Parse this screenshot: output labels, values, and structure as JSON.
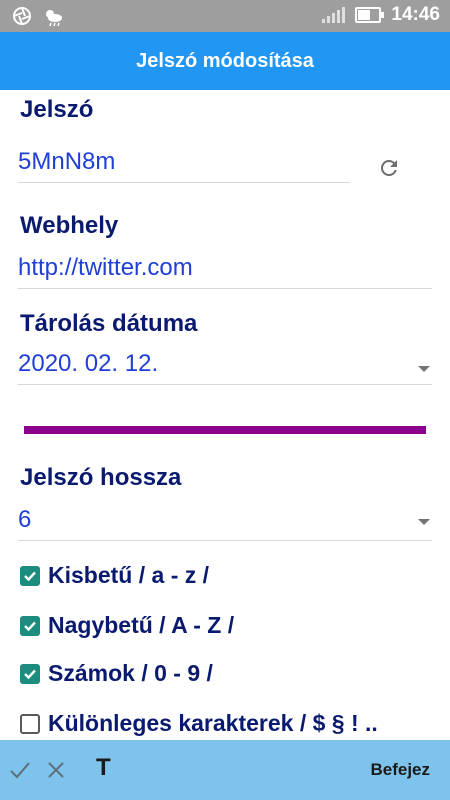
{
  "status_bar": {
    "time": "14:46"
  },
  "header": {
    "title": "Jelszó módosítása"
  },
  "password": {
    "label": "Jelszó",
    "value": "5MnN8m",
    "refresh_icon": "refresh-icon"
  },
  "website": {
    "label": "Webhely",
    "value": "http://twitter.com"
  },
  "storage_date": {
    "label": "Tárolás dátuma",
    "value": "2020. 02. 12."
  },
  "strength_bar": {
    "color": "#8b008b"
  },
  "password_length": {
    "label": "Jelszó hossza",
    "value": "6"
  },
  "options": [
    {
      "label": "Kisbetű / a - z /",
      "checked": true
    },
    {
      "label": "Nagybetű / A - Z /",
      "checked": true
    },
    {
      "label": "Számok / 0 - 9 /",
      "checked": true
    },
    {
      "label": "Különleges karakterek / $ § ! ..",
      "checked": false
    }
  ],
  "toolbar": {
    "t_label": "T",
    "done_label": "Befejez"
  },
  "colors": {
    "accent": "#2196f3",
    "toolbar": "#7ec3ec",
    "checkbox": "#1b8c7d",
    "text": "#0a1a6e",
    "value": "#1f3fd6"
  }
}
